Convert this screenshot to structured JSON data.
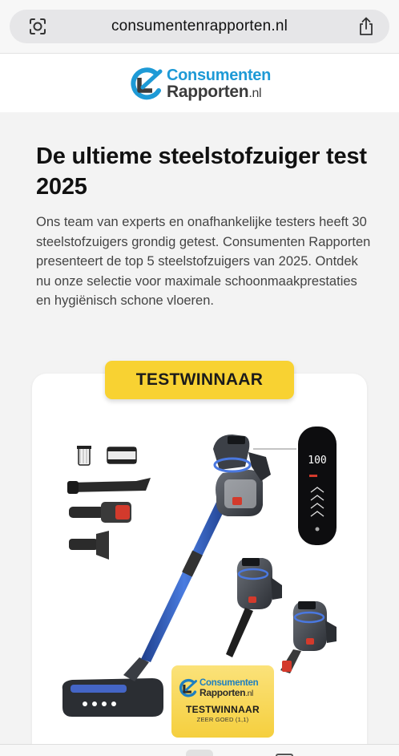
{
  "browser": {
    "url": "consumentenrapporten.nl"
  },
  "site": {
    "logo_line1": "Consumenten",
    "logo_line2": "Rapporten",
    "logo_tld": ".nl"
  },
  "main": {
    "title": "De ultieme steelstofzuiger test 2025",
    "intro": "Ons team van experts en onafhankelijke testers heeft 30 steelstofzuigers grondig getest. Consumenten Rapporten presenteert de top 5 steelstofzuigers van 2025. Ontdek nu onze selectie voor maximale schoonmaakprestaties en hygiënisch schone vloeren."
  },
  "card": {
    "badge": "TESTWINNAAR",
    "display_reading": "100",
    "seal": {
      "logo_line1": "Consumenten",
      "logo_line2": "Rapporten",
      "logo_tld": ".nl",
      "title": "TESTWINNAAR",
      "subtitle": "ZEER GOED (1,1)"
    }
  },
  "colors": {
    "brand_blue": "#1e9ad6",
    "badge_yellow": "#f8d232",
    "vacuum_blue": "#2f5fbf"
  },
  "icons": {
    "url_left": "site-settings-icon",
    "url_right": "share-icon"
  }
}
